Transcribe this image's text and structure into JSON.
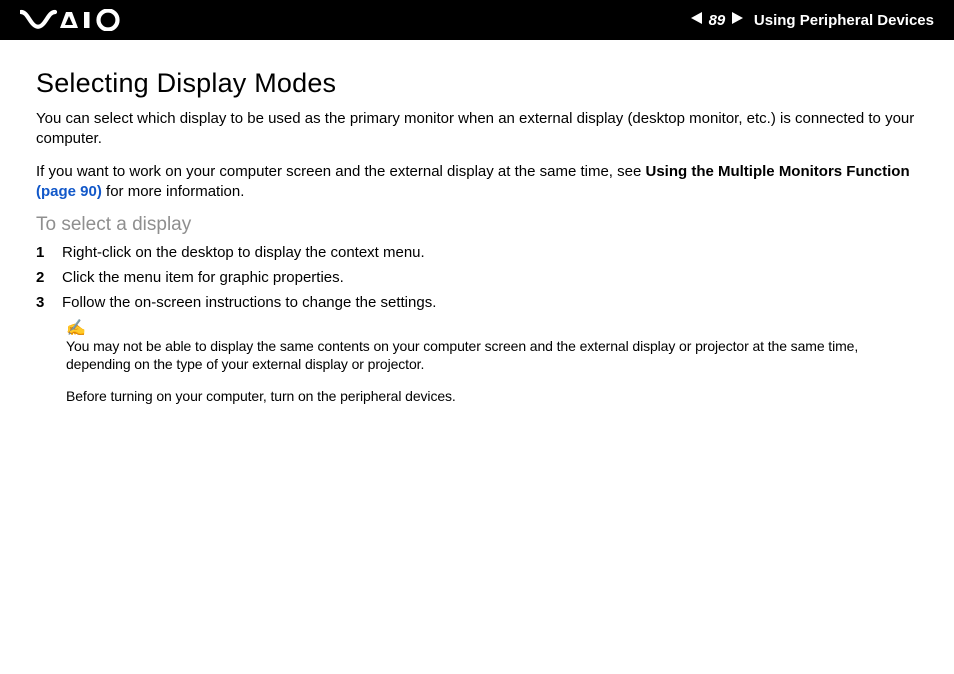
{
  "header": {
    "page_number": "89",
    "section_title": "Using Peripheral Devices"
  },
  "body": {
    "title": "Selecting Display Modes",
    "para1": "You can select which display to be used as the primary monitor when an external display (desktop monitor, etc.) is connected to your computer.",
    "para2_pre": "If you want to work on your computer screen and the external display at the same time, see ",
    "para2_bold": "Using the Multiple Monitors Function ",
    "para2_link": "(page 90)",
    "para2_post": " for more information.",
    "subheading": "To select a display",
    "steps": [
      {
        "n": "1",
        "t": "Right-click on the desktop to display the context menu."
      },
      {
        "n": "2",
        "t": "Click the menu item for graphic properties."
      },
      {
        "n": "3",
        "t": "Follow the on-screen instructions to change the settings."
      }
    ],
    "note1": "You may not be able to display the same contents on your computer screen and the external display or projector at the same time, depending on the type of your external display or projector.",
    "note2": "Before turning on your computer, turn on the peripheral devices."
  }
}
